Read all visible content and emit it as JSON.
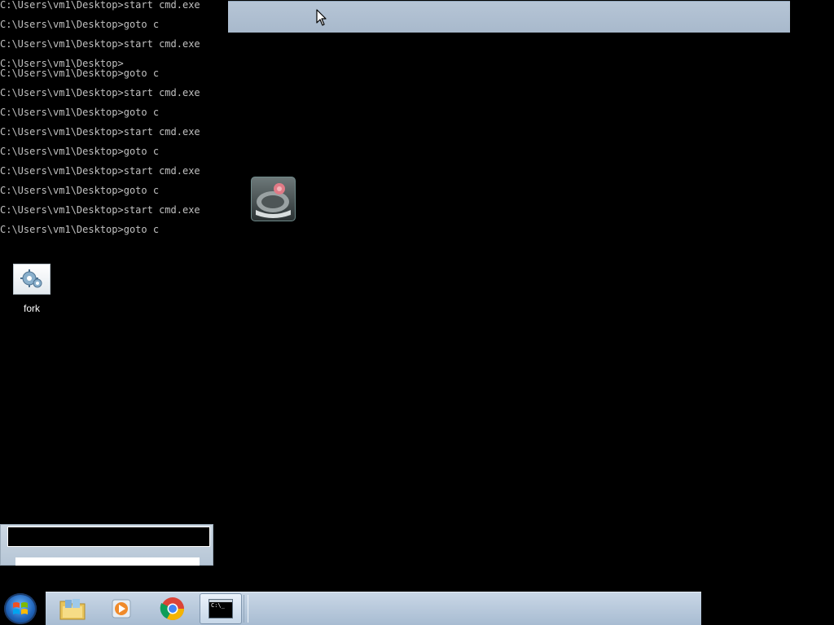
{
  "console": {
    "lines": [
      "C:\\Users\\vm1\\Desktop>start cmd.exe",
      "C:\\Users\\vm1\\Desktop>goto c",
      "C:\\Users\\vm1\\Desktop>start cmd.exe",
      "C:\\Users\\vm1\\Desktop>",
      "C:\\Users\\vm1\\Desktop>goto c",
      "C:\\Users\\vm1\\Desktop>start cmd.exe",
      "C:\\Users\\vm1\\Desktop>goto c",
      "C:\\Users\\vm1\\Desktop>start cmd.exe",
      "C:\\Users\\vm1\\Desktop>goto c",
      "C:\\Users\\vm1\\Desktop>start cmd.exe",
      "C:\\Users\\vm1\\Desktop>goto c",
      "C:\\Users\\vm1\\Desktop>start cmd.exe",
      "C:\\Users\\vm1\\Desktop>goto c"
    ]
  },
  "desktop": {
    "icons": [
      {
        "label": "fork",
        "icon": "gears-icon"
      }
    ],
    "floating_icon": "media-player-icon"
  },
  "taskbar": {
    "start_icon": "windows-logo-icon",
    "apps": [
      {
        "icon": "folder-icon",
        "active": false
      },
      {
        "icon": "media-player-icon",
        "active": false
      },
      {
        "icon": "chrome-icon",
        "active": false
      },
      {
        "icon": "cmd-icon",
        "active": true
      }
    ],
    "cmd_icon_text": "C:\\_"
  },
  "colors": {
    "console_text": "#c0c0c0",
    "taskbar": "#b6c8db",
    "desktop_bg": "#000000"
  }
}
